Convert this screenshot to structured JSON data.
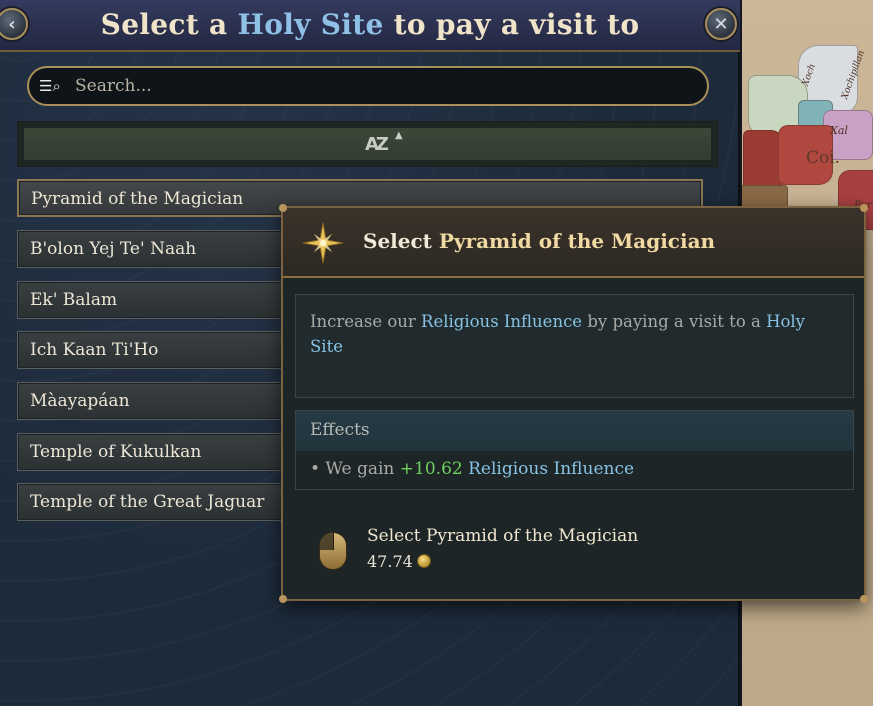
{
  "dialog": {
    "title_prefix": "Select a ",
    "title_highlight": "Holy Site",
    "title_suffix": " to pay a visit to",
    "back_glyph": "‹",
    "close_glyph": "✕"
  },
  "search": {
    "icon": "search-icon",
    "placeholder": "Search...",
    "value": ""
  },
  "sort": {
    "icon": "sort-alpha-icon",
    "glyph": "AZ",
    "direction_glyph": "▲"
  },
  "holy_sites": [
    {
      "label": "Pyramid of the Magician"
    },
    {
      "label": "B'olon Yej Te' Naah"
    },
    {
      "label": "Ek' Balam"
    },
    {
      "label": "Ich Kaan Ti'Ho"
    },
    {
      "label": "Màayapáan"
    },
    {
      "label": "Temple of Kukulkan"
    },
    {
      "label": "Temple of the Great Jaguar"
    }
  ],
  "selected_index": 0,
  "tooltip": {
    "title_prefix": "Select ",
    "title_highlight": "Pyramid of the Magician",
    "desc_part1": "Increase our ",
    "desc_link1": "Religious Influence",
    "desc_part2": " by paying a visit to a ",
    "desc_link2": "Holy Site",
    "effects_heading": "Effects",
    "effect_prefix": "• We gain ",
    "effect_value": "+10.62",
    "effect_link": " Religious Influence",
    "action_label": "Select Pyramid of the Magician",
    "action_cost": "47.74",
    "action_icon": "mouse-left-click-icon",
    "cost_icon": "gold-coin-icon"
  },
  "map": {
    "labels": [
      "Coi.",
      "Xal",
      "Xoch",
      "Xochipillan",
      "Pur"
    ]
  },
  "colors": {
    "accent_gold": "#a88f5c",
    "link_blue": "#86c3e4",
    "positive_green": "#6ecf5e",
    "title_highlight": "#8fc0e6"
  }
}
